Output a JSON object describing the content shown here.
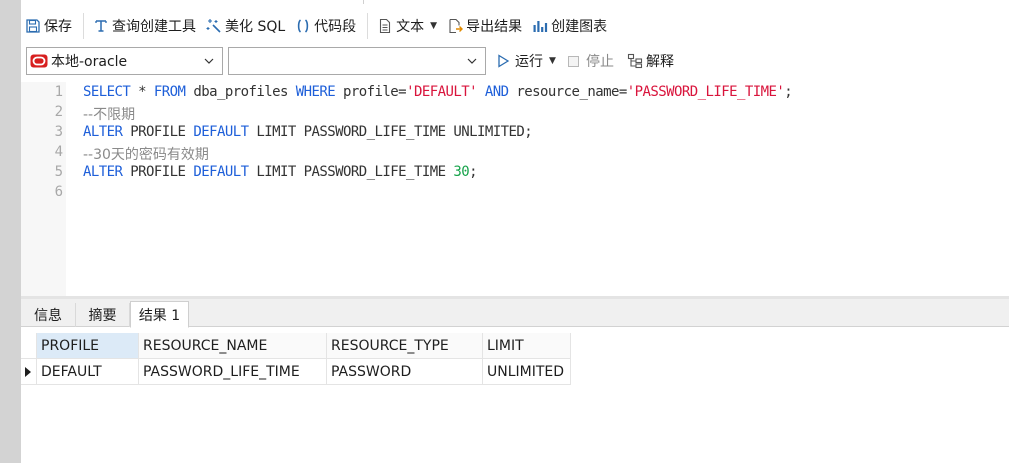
{
  "toolbar": {
    "save_label": "保存",
    "query_builder_label": "查询创建工具",
    "beautify_label": "美化 SQL",
    "snippet_label": "代码段",
    "text_label": "文本",
    "export_label": "导出结果",
    "chart_label": "创建图表"
  },
  "connection": {
    "selected": "本地-oracle",
    "database_selected": "",
    "brand_color": "#d71f1f"
  },
  "run_bar": {
    "run_label": "运行",
    "stop_label": "停止",
    "explain_label": "解释"
  },
  "editor": {
    "line_numbers": [
      "1",
      "2",
      "3",
      "4",
      "5",
      "6"
    ],
    "lines": [
      [
        {
          "t": "kw",
          "v": "SELECT"
        },
        {
          "t": "plain",
          "v": " * "
        },
        {
          "t": "kw",
          "v": "FROM"
        },
        {
          "t": "plain",
          "v": " dba_profiles "
        },
        {
          "t": "kw",
          "v": "WHERE"
        },
        {
          "t": "plain",
          "v": " profile="
        },
        {
          "t": "str",
          "v": "'DEFAULT'"
        },
        {
          "t": "plain",
          "v": " "
        },
        {
          "t": "kw",
          "v": "AND"
        },
        {
          "t": "plain",
          "v": " resource_name="
        },
        {
          "t": "str",
          "v": "'PASSWORD_LIFE_TIME'"
        },
        {
          "t": "plain",
          "v": ";"
        }
      ],
      [
        {
          "t": "cm",
          "v": "--不限期"
        }
      ],
      [
        {
          "t": "kw",
          "v": "ALTER"
        },
        {
          "t": "plain",
          "v": " PROFILE "
        },
        {
          "t": "kw",
          "v": "DEFAULT"
        },
        {
          "t": "plain",
          "v": " LIMIT PASSWORD_LIFE_TIME UNLIMITED;"
        }
      ],
      [
        {
          "t": "cm",
          "v": "--30天的密码有效期"
        }
      ],
      [
        {
          "t": "kw",
          "v": "ALTER"
        },
        {
          "t": "plain",
          "v": " PROFILE "
        },
        {
          "t": "kw",
          "v": "DEFAULT"
        },
        {
          "t": "plain",
          "v": " LIMIT PASSWORD_LIFE_TIME "
        },
        {
          "t": "num",
          "v": "30"
        },
        {
          "t": "plain",
          "v": ";"
        }
      ],
      []
    ]
  },
  "result_tabs": [
    "信息",
    "摘要",
    "结果 1"
  ],
  "result_grid": {
    "columns": [
      "PROFILE",
      "RESOURCE_NAME",
      "RESOURCE_TYPE",
      "LIMIT"
    ],
    "rows": [
      [
        "DEFAULT",
        "PASSWORD_LIFE_TIME",
        "PASSWORD",
        "UNLIMITED"
      ]
    ]
  },
  "colors": {
    "keyword": "#1e5fd9",
    "string": "#d9143c",
    "number": "#16a34a",
    "comment": "#8a8a8a",
    "icon": "#2b6cb0"
  }
}
